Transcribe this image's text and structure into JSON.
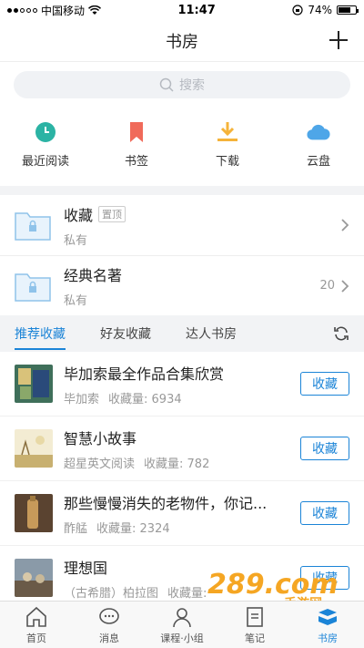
{
  "status": {
    "carrier": "中国移动",
    "time": "11:47",
    "battery": "74%"
  },
  "nav": {
    "title": "书房"
  },
  "search": {
    "placeholder": "搜索"
  },
  "quick": [
    {
      "label": "最近阅读",
      "icon": "clock-icon",
      "color": "#2bb3a4"
    },
    {
      "label": "书签",
      "icon": "bookmark-icon",
      "color": "#f06a5a"
    },
    {
      "label": "下载",
      "icon": "download-icon",
      "color": "#f5b33a"
    },
    {
      "label": "云盘",
      "icon": "cloud-icon",
      "color": "#4ea6e8"
    }
  ],
  "folders": [
    {
      "title": "收藏",
      "tag": "置顶",
      "sub": "私有",
      "count": ""
    },
    {
      "title": "经典名著",
      "tag": "",
      "sub": "私有",
      "count": "20"
    }
  ],
  "tabs": [
    "推荐收藏",
    "好友收藏",
    "达人书房"
  ],
  "recs": [
    {
      "title": "毕加索最全作品合集欣赏",
      "author": "毕加索",
      "count": "收藏量: 6934",
      "button": "收藏"
    },
    {
      "title": "智慧小故事",
      "author": "超星英文阅读",
      "count": "收藏量: 782",
      "button": "收藏"
    },
    {
      "title": "那些慢慢消失的老物件，你记...",
      "author": "酢艋",
      "count": "收藏量: 2324",
      "button": "收藏"
    },
    {
      "title": "理想国",
      "author": "（古希腊）柏拉图",
      "count": "收藏量:",
      "button": "收藏"
    }
  ],
  "tabbar": [
    "首页",
    "消息",
    "课程·小组",
    "笔记",
    "书房"
  ],
  "colors": {
    "accent": "#1b84d7",
    "folder": "#8fc3ea"
  },
  "watermark": {
    "text": "289.com",
    "sub": "手游网"
  }
}
